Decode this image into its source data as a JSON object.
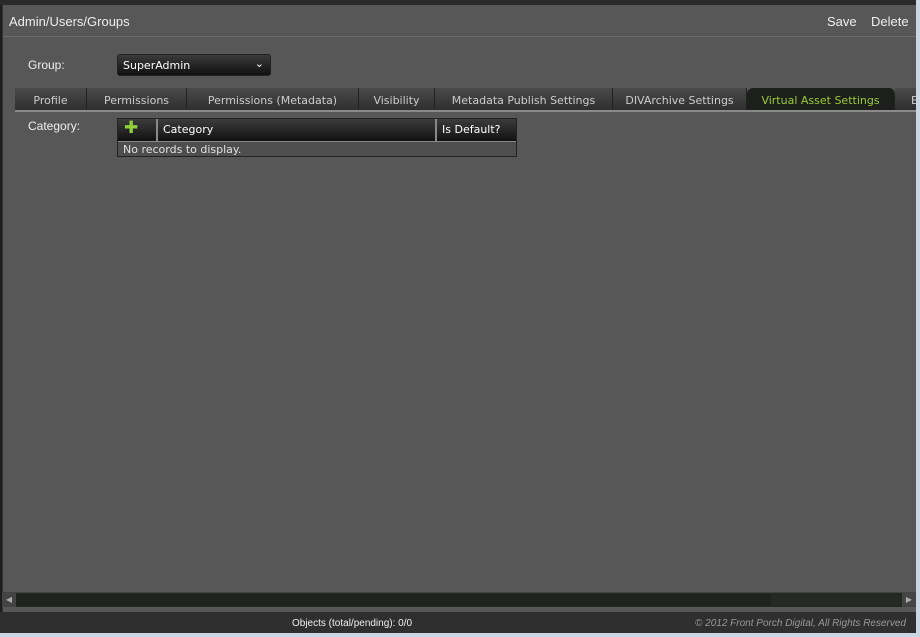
{
  "header": {
    "title": "Admin/Users/Groups",
    "save_label": "Save",
    "delete_label": "Delete"
  },
  "group": {
    "label": "Group:",
    "selected": "SuperAdmin"
  },
  "tabs": [
    {
      "label": "Profile"
    },
    {
      "label": "Permissions"
    },
    {
      "label": "Permissions (Metadata)"
    },
    {
      "label": "Visibility"
    },
    {
      "label": "Metadata Publish Settings"
    },
    {
      "label": "DIVArchive Settings"
    },
    {
      "label": "Virtual Asset Settings",
      "active": true
    },
    {
      "label": "E"
    }
  ],
  "category": {
    "label": "Category:",
    "columns": [
      "Category",
      "Is Default?"
    ],
    "empty_text": "No records to display.",
    "add_icon": "plus-icon"
  },
  "status": {
    "objects": "Objects (total/pending): 0/0",
    "copyright": "© 2012 Front Porch Digital, All Rights Reserved"
  },
  "colors": {
    "active_tab": "#9acd32",
    "add_icon": "#8fd13a"
  }
}
